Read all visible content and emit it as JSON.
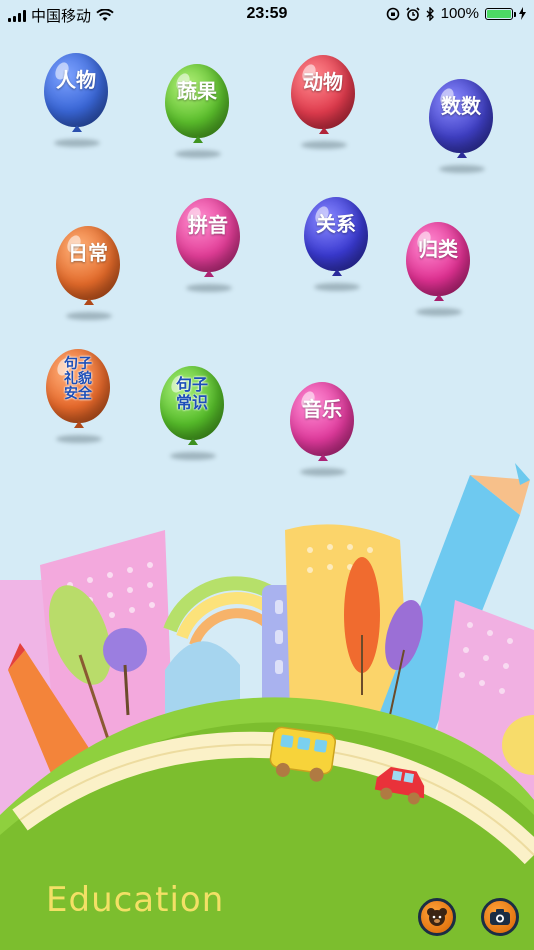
{
  "status_bar": {
    "carrier": "中国移动",
    "time": "23:59",
    "battery": "100%"
  },
  "balloons": [
    {
      "label": "人物",
      "color": "#3a67d8"
    },
    {
      "label": "蔬果",
      "color": "#5bbf2c"
    },
    {
      "label": "动物",
      "color": "#e03b4d"
    },
    {
      "label": "数数",
      "color": "#3f3fc4"
    },
    {
      "label": "日常",
      "color": "#e36a2a"
    },
    {
      "label": "拼音",
      "color": "#e23d97"
    },
    {
      "label": "关系",
      "color": "#3a3ad1"
    },
    {
      "label": "归类",
      "color": "#e03192"
    },
    {
      "label": "句子礼貌安全",
      "lines": [
        "句子",
        "礼貌",
        "安全"
      ],
      "color": "#e86a2c"
    },
    {
      "label": "句子常识",
      "lines": [
        "句子",
        "常识"
      ],
      "color": "#56bd2a"
    },
    {
      "label": "音乐",
      "color": "#e03a9c"
    }
  ],
  "footer": {
    "brand_text": "Education",
    "buttons": [
      {
        "icon": "bear-icon"
      },
      {
        "icon": "camera-icon"
      }
    ]
  }
}
